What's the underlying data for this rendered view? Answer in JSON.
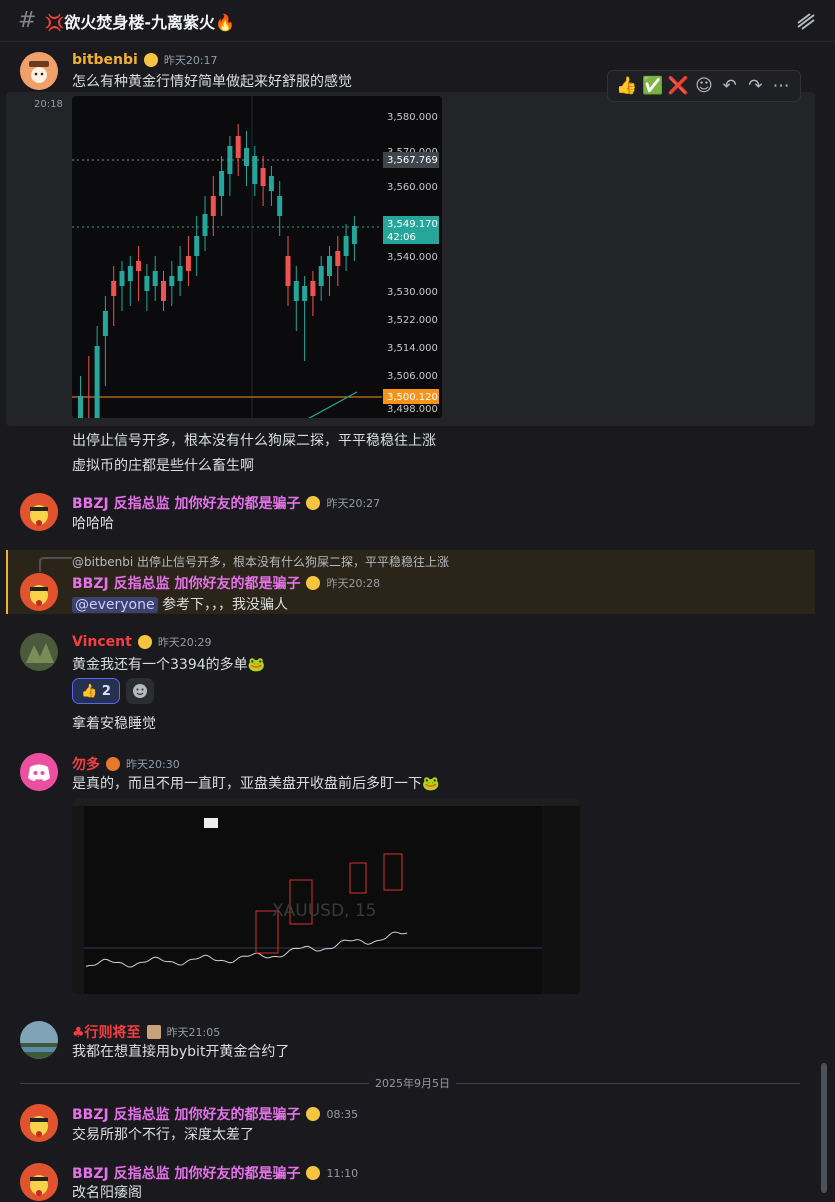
{
  "channel": {
    "title": "💢欲火焚身楼-九离紫火🔥"
  },
  "toolbar": {
    "reactions": [
      "👍",
      "✅",
      "❌"
    ],
    "icons": [
      "add-reaction-icon",
      "reply-icon",
      "forward-icon",
      "more-icon"
    ]
  },
  "messages": [
    {
      "user": "bitbenbi",
      "time": "昨天20:17",
      "color": "#f0b232",
      "lines": [
        "怎么有种黄金行情好简单做起来好舒服的感觉"
      ]
    },
    {
      "side_time": "20:18",
      "lines": [
        "出停止信号开多，根本没有什么狗屎二探，平平稳稳往上涨",
        "虚拟币的庄都是些什么畜生啊"
      ]
    },
    {
      "user": "BBZJ 反指总监  加你好友的都是骗子",
      "time": "昨天20:27",
      "color": "#e472e8",
      "lines": [
        "哈哈哈"
      ]
    },
    {
      "reply_preview": "@bitbenbi 出停止信号开多，根本没有什么狗屎二探，平平稳稳往上涨",
      "user": "BBZJ 反指总监  加你好友的都是骗子",
      "time": "昨天20:28",
      "color": "#e472e8",
      "mention": "@everyone",
      "lines": [
        "参考下，，，我没骗人"
      ]
    },
    {
      "user": "Vincent",
      "time": "昨天20:29",
      "color": "#f23f43",
      "lines": [
        "黄金我还有一个3394的多单🐸",
        "拿着安稳睡觉"
      ],
      "reaction": {
        "emoji": "👍",
        "count": "2"
      }
    },
    {
      "user": "勿多",
      "time": "昨天20:30",
      "color": "#f23f43",
      "lines": [
        "是真的，而且不用一直盯，亚盘美盘开收盘前后多盯一下🐸"
      ]
    },
    {
      "user": "♣行则将至",
      "time": "昨天21:05",
      "color": "#f23f43",
      "lines": [
        "我都在想直接用bybit开黄金合约了"
      ]
    },
    {
      "user": "BBZJ 反指总监  加你好友的都是骗子",
      "time": "08:35",
      "color": "#e472e8",
      "lines": [
        "交易所那个不行，深度太差了"
      ]
    },
    {
      "user": "BBZJ 反指总监  加你好友的都是骗子",
      "time": "11:10",
      "color": "#e472e8",
      "lines": [
        "改名阳痿阁"
      ]
    }
  ],
  "date_divider": "2025年9月5日",
  "chart1": {
    "price_labels": [
      "3,580.000",
      "3,570.000",
      "3,560.000",
      "3,549.170",
      "3,540.000",
      "3,530.000",
      "3,522.000",
      "3,514.000",
      "3,506.000",
      "3,500.120",
      "3,498.000"
    ],
    "crosshair_label": "3,567.769",
    "current_price": "3,549.170",
    "countdown": "42:06",
    "level_label": "3,500.120"
  },
  "chart2": {
    "watermark": "XAUUSD, 15"
  }
}
